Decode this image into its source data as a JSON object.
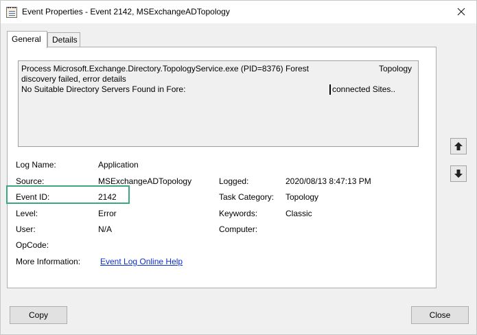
{
  "window": {
    "title": "Event Properties - Event 2142, MSExchangeADTopology",
    "icon": "event-log-icon"
  },
  "tabs": [
    {
      "label": "General",
      "selected": true
    },
    {
      "label": "Details",
      "selected": false
    }
  ],
  "description": {
    "line1_left": "Process Microsoft.Exchange.Directory.TopologyService.exe (PID=8376) Forest",
    "line1_right": "Topology",
    "line2": "discovery failed, error details",
    "line3_left": "No Suitable Directory Servers Found in Fore:",
    "line3_right": "connected Sites.."
  },
  "properties": {
    "log_name": {
      "label": "Log Name:",
      "value": "Application"
    },
    "source": {
      "label": "Source:",
      "value": "MSExchangeADTopology"
    },
    "event_id": {
      "label": "Event ID:",
      "value": "2142"
    },
    "level": {
      "label": "Level:",
      "value": "Error"
    },
    "user": {
      "label": "User:",
      "value": "N/A"
    },
    "opcode": {
      "label": "OpCode:",
      "value": ""
    },
    "more_info": {
      "label": "More Information:",
      "link": "Event Log Online Help"
    },
    "logged": {
      "label": "Logged:",
      "value": "2020/08/13 8:47:13 PM"
    },
    "task_category": {
      "label": "Task Category:",
      "value": "Topology"
    },
    "keywords": {
      "label": "Keywords:",
      "value": "Classic"
    },
    "computer": {
      "label": "Computer:",
      "value": ""
    }
  },
  "nav": {
    "up_icon": "arrow-up-icon",
    "down_icon": "arrow-down-icon"
  },
  "buttons": {
    "copy": "Copy",
    "close": "Close"
  },
  "colors": {
    "highlight": "#3aa77d",
    "link": "#0a2fd3"
  }
}
